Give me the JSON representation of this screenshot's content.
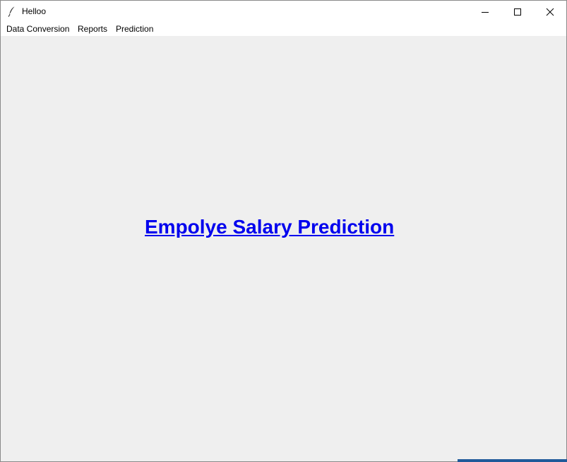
{
  "window": {
    "title": "Helloo",
    "icon": "feather-icon",
    "controls": [
      "minimize-icon",
      "maximize-icon",
      "close-icon"
    ]
  },
  "menubar": {
    "items": [
      {
        "label": "Data Conversion"
      },
      {
        "label": "Reports"
      },
      {
        "label": "Prediction"
      }
    ]
  },
  "main": {
    "heading": "Empolye Salary Prediction",
    "heading_color": "#0000ee"
  },
  "colors": {
    "content_bg": "#efefef",
    "titlebar_bg": "#ffffff"
  }
}
